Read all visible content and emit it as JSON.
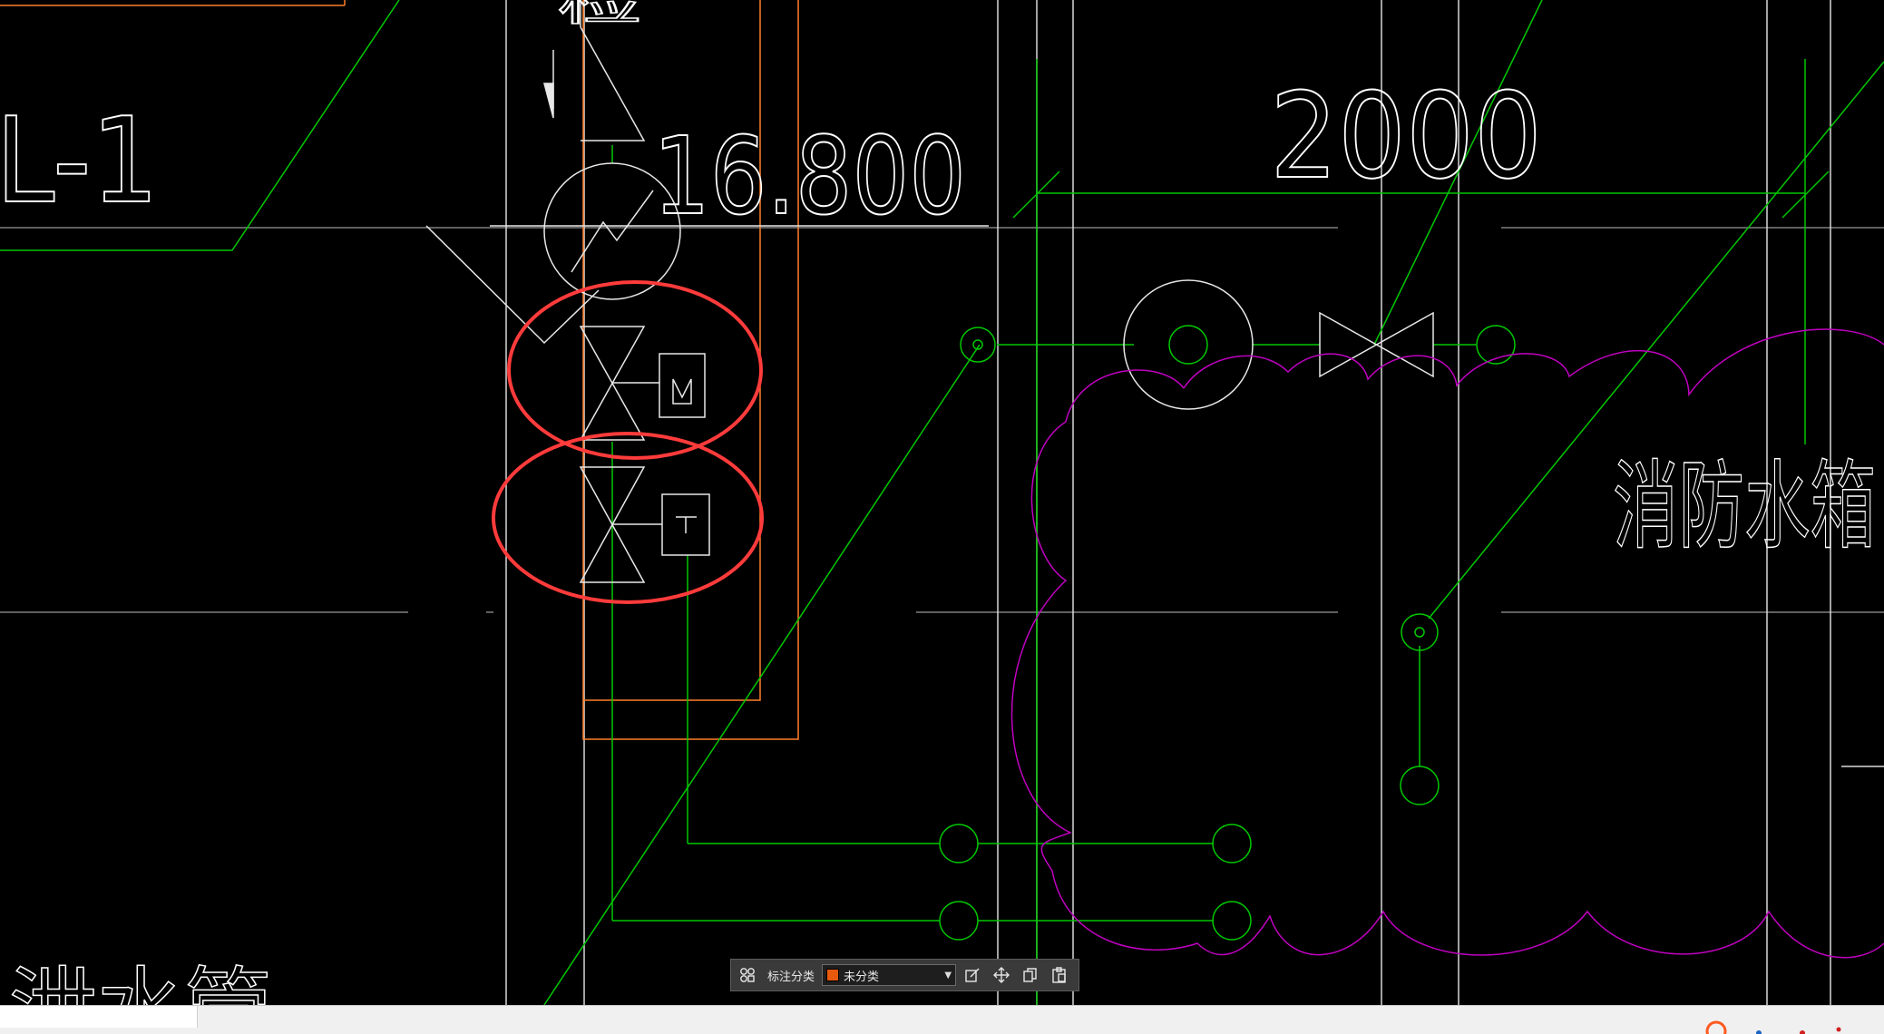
{
  "drawing": {
    "labels": {
      "elevation": "16.800",
      "dimension": "2000",
      "tank_label": "消防水箱",
      "riser_label": "L-1",
      "pipe_label": "泄水管",
      "top_label": "检"
    }
  },
  "toolbar": {
    "layout_icon": "grid-icon",
    "category_label": "标注分类",
    "category_value": "未分类",
    "category_color": "#e8590c",
    "edit_icon": "edit-icon",
    "move_icon": "move-icon",
    "copy_icon": "copy-icon",
    "paste_icon": "paste-icon"
  },
  "colors": {
    "background": "#000000",
    "pipe": "#00c800",
    "wall": "#d8d8d8",
    "structure": "#ff7f2a",
    "revision_cloud": "#c000c0",
    "highlight": "#ff3b3b"
  }
}
